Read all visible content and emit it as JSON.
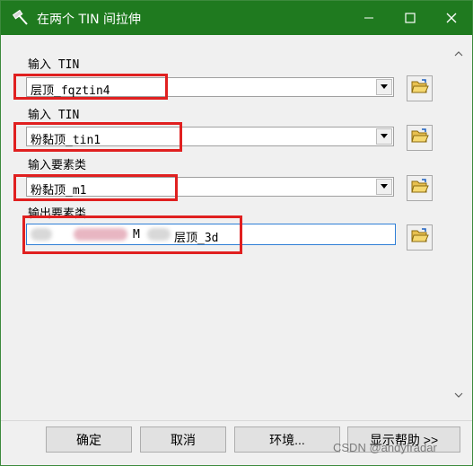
{
  "window": {
    "title": "在两个 TIN 间拉伸",
    "title_bar_color": "#1f7a1f",
    "controls": {
      "minimize": "—",
      "maximize": "☐",
      "close": "✕"
    }
  },
  "fields": [
    {
      "label": "输入 TIN",
      "value": "层顶_fqztin4"
    },
    {
      "label": "输入 TIN",
      "value": "粉黏顶_tin1"
    },
    {
      "label": "输入要素类",
      "value": "粉黏顶_m1"
    },
    {
      "label": "输出要素类",
      "value": "层顶_3d",
      "value_prefix_visible": "Y",
      "value_prefix2_visible": "M"
    }
  ],
  "highlight_color": "#e02020",
  "buttons": {
    "ok": "确定",
    "cancel": "取消",
    "environments": "环境...",
    "show_help": "显示帮助 >>"
  },
  "watermark": "CSDN @andyfradar"
}
